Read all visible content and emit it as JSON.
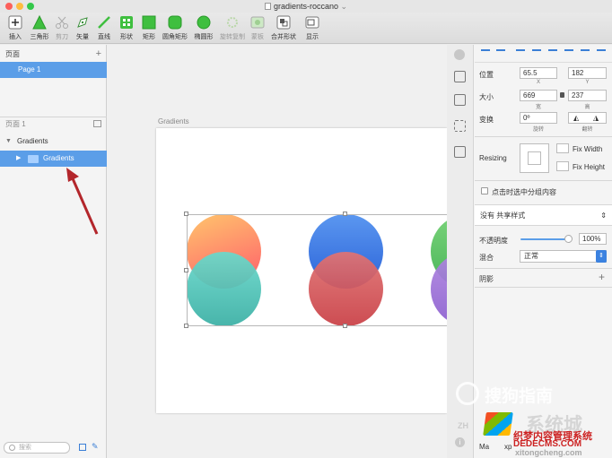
{
  "window": {
    "title": "gradients-roccano"
  },
  "toolbar": {
    "tools": [
      {
        "label": "插入",
        "icon": "plus-icon"
      },
      {
        "label": "三角形",
        "icon": "triangle-icon"
      },
      {
        "label": "剪刀",
        "icon": "scissors-icon"
      },
      {
        "label": "矢量",
        "icon": "pen-icon"
      },
      {
        "label": "直线",
        "icon": "line-icon"
      },
      {
        "label": "形状",
        "icon": "shapes-icon"
      },
      {
        "label": "矩形",
        "icon": "rectangle-icon"
      },
      {
        "label": "圆角矩形",
        "icon": "rounded-rectangle-icon"
      },
      {
        "label": "椭圆形",
        "icon": "oval-icon"
      },
      {
        "label": "旋转复制",
        "icon": "rotate-copy-icon"
      },
      {
        "label": "蒙板",
        "icon": "mask-icon"
      },
      {
        "label": "合并形状",
        "icon": "combine-shapes-icon"
      },
      {
        "label": "显示",
        "icon": "view-icon"
      }
    ]
  },
  "pages_panel": {
    "header": "页面",
    "pages": [
      "Page 1"
    ],
    "layers_header": "页面 1",
    "layers": [
      {
        "label": "Gradients"
      },
      {
        "label": "Gradients"
      }
    ],
    "search_placeholder": "搜索"
  },
  "canvas": {
    "artboard_label": "Gradients",
    "circle_colors": [
      "#f8b466",
      "#ef4d6a",
      "#5fd2c5",
      "#3fb3a6",
      "#4d8fea",
      "#2f6fe0",
      "#d96a6a",
      "#c94444",
      "#6bcf74",
      "#a179d9"
    ]
  },
  "inspector": {
    "position_label": "位置",
    "x": "65.5",
    "x_sub": "X",
    "y": "182",
    "y_sub": "Y",
    "size_label": "大小",
    "width": "669",
    "width_sub": "宽",
    "height": "237",
    "height_sub": "高",
    "transform_label": "变换",
    "rotation": "0º",
    "rotation_sub": "旋转",
    "flip_sub": "翻转",
    "resizing_label": "Resizing",
    "fix_width": "Fix Width",
    "fix_height": "Fix Height",
    "group_click_label": "点击时选中分组内容",
    "shared_style": "没有 共享样式",
    "opacity_label": "不透明度",
    "opacity_value": "100%",
    "opacity": 1.0,
    "blend_label": "混合",
    "blend_value": "正常",
    "shadow_label": "阴影",
    "export_partial": "Ma",
    "export_partial2": "xp"
  },
  "watermark": {
    "sogou": "搜狗指南",
    "site_cn": "系统城",
    "site_url": "xitongcheng.com",
    "dede_cn": "织梦内容管理系统",
    "dede_url": "DEDECMS.COM",
    "zh_partial": "ZH"
  },
  "colors": {
    "accent": "#5b9ee8",
    "arrow": "#b3262b"
  }
}
